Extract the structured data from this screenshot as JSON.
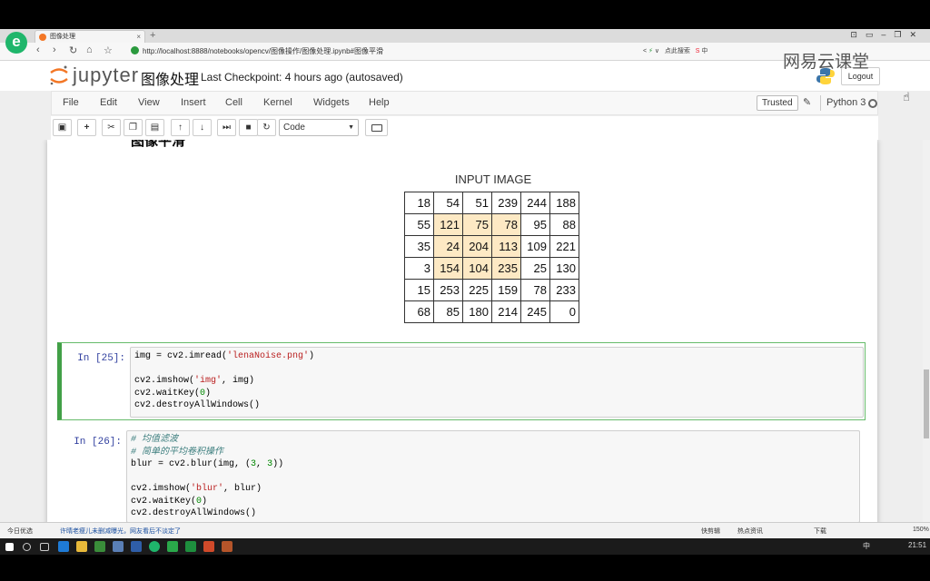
{
  "browser": {
    "tab_title": "图像处理",
    "url": "http://localhost:8888/notebooks/opencv/图像操作/图像处理.ipynb#图像平滑",
    "search_engine_hint": "点此搜索",
    "watermark": "网易云课堂"
  },
  "jupyter": {
    "logo_text": "jupyter",
    "notebook_title": "图像处理",
    "checkpoint": "Last Checkpoint: 4 hours ago (autosaved)",
    "logout_label": "Logout",
    "menu": [
      "File",
      "Edit",
      "View",
      "Insert",
      "Cell",
      "Kernel",
      "Widgets",
      "Help"
    ],
    "trusted_label": "Trusted",
    "kernel_name": "Python 3",
    "cell_type": "Code"
  },
  "notebook": {
    "heading": "图像平滑",
    "figure": {
      "title": "INPUT IMAGE",
      "rows": [
        [
          "18",
          "54",
          "51",
          "239",
          "244",
          "188"
        ],
        [
          "55",
          "121",
          "75",
          "78",
          "95",
          "88"
        ],
        [
          "35",
          "24",
          "204",
          "113",
          "109",
          "221"
        ],
        [
          "3",
          "154",
          "104",
          "235",
          "25",
          "130"
        ],
        [
          "15",
          "253",
          "225",
          "159",
          "78",
          "233"
        ],
        [
          "68",
          "85",
          "180",
          "214",
          "245",
          "0"
        ]
      ],
      "highlight_color": "#fde9c4"
    },
    "cells": [
      {
        "prompt": "In [25]:",
        "lines": [
          "img = cv2.imread('lenaNoise.png')",
          "",
          "cv2.imshow('img', img)",
          "cv2.waitKey(0)",
          "cv2.destroyAllWindows()"
        ]
      },
      {
        "prompt": "In [26]:",
        "lines": [
          "# 均值滤波",
          "# 简单的平均卷积操作",
          "blur = cv2.blur(img, (3, 3))",
          "",
          "cv2.imshow('blur', blur)",
          "cv2.waitKey(0)",
          "cv2.destroyAllWindows()"
        ]
      }
    ]
  },
  "statusbar": {
    "left_label": "今日优选",
    "tip": "许晴老瘦儿未删减曝光，网友看后不淡定了",
    "video_label": "快剪辑",
    "news_label": "热点资讯",
    "download_label": "下载",
    "zoom": "150%"
  },
  "taskbar": {
    "lang": "中",
    "time": "21:51"
  },
  "colors": {
    "jupyter_orange": "#f37726",
    "selected_cell_border": "#42a047",
    "prompt_blue": "#303f9f"
  }
}
